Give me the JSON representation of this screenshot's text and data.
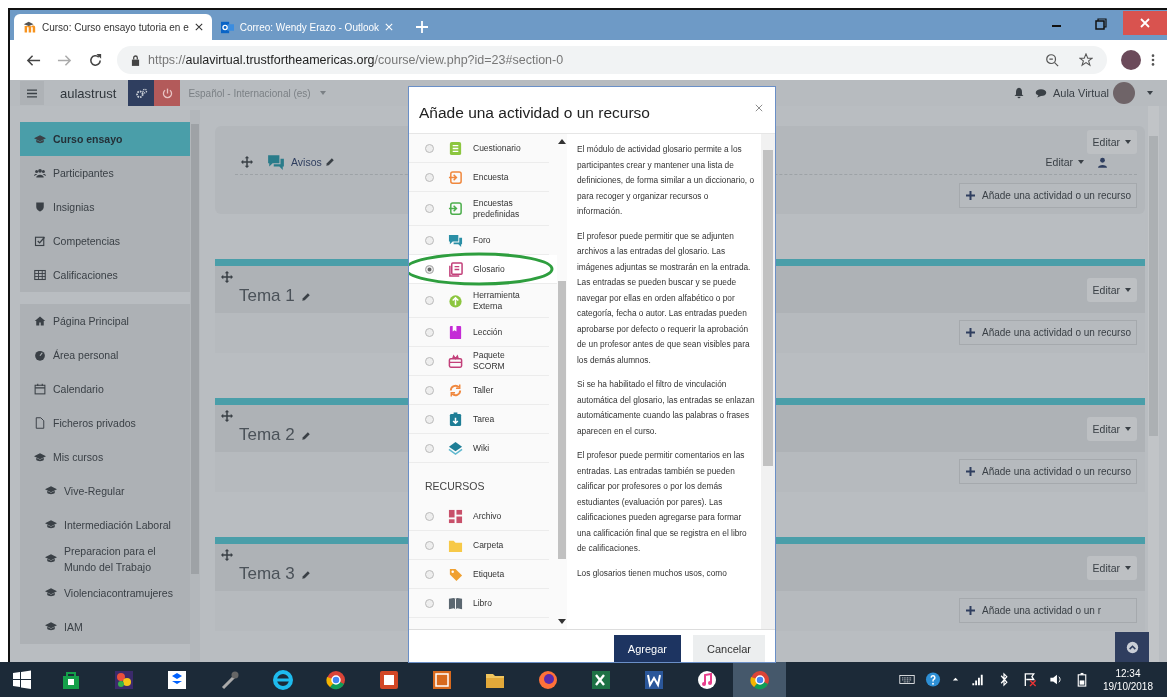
{
  "browser": {
    "tabs": [
      {
        "title": "Curso: Curso ensayo tutoria en e",
        "selected": true
      },
      {
        "title": "Correo: Wendy Erazo - Outlook",
        "selected": false
      }
    ],
    "url": {
      "scheme": "https://",
      "host": "aulavirtual.trustfortheamericas.org",
      "path": "/course/view.php?id=23#section-0"
    }
  },
  "navbar": {
    "brand": "aulastrust",
    "language": "Español - Internacional (es)",
    "user": "Aula Virtual"
  },
  "sidebar": {
    "sections": [
      {
        "items": [
          {
            "label": "Curso ensayo",
            "kind": "course",
            "selected": true
          },
          {
            "label": "Participantes",
            "kind": "users",
            "selected": false
          },
          {
            "label": "Insignias",
            "kind": "badge",
            "selected": false
          },
          {
            "label": "Competencias",
            "kind": "check",
            "selected": false
          },
          {
            "label": "Calificaciones",
            "kind": "table",
            "selected": false
          }
        ]
      },
      {
        "items": [
          {
            "label": "Página Principal",
            "kind": "home",
            "selected": false
          },
          {
            "label": "Área personal",
            "kind": "dashboard",
            "selected": false
          },
          {
            "label": "Calendario",
            "kind": "calendar",
            "selected": false
          },
          {
            "label": "Ficheros privados",
            "kind": "file",
            "selected": false
          },
          {
            "label": "Mis cursos",
            "kind": "course",
            "selected": false,
            "children": [
              {
                "label": "Vive-Regular",
                "kind": "course",
                "selected": false
              },
              {
                "label": "Intermediación Laboral",
                "kind": "course",
                "selected": false
              },
              {
                "label": "Preparacion para el Mundo del Trabajo",
                "kind": "course",
                "selected": false
              },
              {
                "label": "Violenciacontramujeres",
                "kind": "course",
                "selected": false
              },
              {
                "label": "IAM",
                "kind": "course",
                "selected": false
              }
            ]
          }
        ]
      }
    ]
  },
  "course": {
    "section_edit": "Editar",
    "announcements": {
      "title": "Avisos",
      "edit": "Editar",
      "add": "Añade una actividad o un recurso"
    },
    "topics": [
      {
        "title": "Tema 1",
        "edit": "Editar",
        "add": "Añade una actividad o un recurso"
      },
      {
        "title": "Tema 2",
        "edit": "Editar",
        "add": "Añade una actividad o un recurso"
      },
      {
        "title": "Tema 3",
        "edit": "Editar",
        "add": "Añade una actividad o un r"
      }
    ]
  },
  "modal": {
    "title": "Añade una actividad o un recurso",
    "activities": [
      {
        "label": "Cuestionario",
        "kind": "quiz",
        "selected": false
      },
      {
        "label": "Encuesta",
        "kind": "survey",
        "selected": false
      },
      {
        "label": "Encuestas predefinidas",
        "kind": "feedback",
        "selected": false
      },
      {
        "label": "Foro",
        "kind": "forum",
        "selected": false
      },
      {
        "label": "Glosario",
        "kind": "glossary",
        "selected": true
      },
      {
        "label": "Herramienta Externa",
        "kind": "lti",
        "selected": false
      },
      {
        "label": "Lección",
        "kind": "lesson",
        "selected": false
      },
      {
        "label": "Paquete SCORM",
        "kind": "scorm",
        "selected": false
      },
      {
        "label": "Taller",
        "kind": "workshop",
        "selected": false
      },
      {
        "label": "Tarea",
        "kind": "assign",
        "selected": false
      },
      {
        "label": "Wiki",
        "kind": "wiki",
        "selected": false
      }
    ],
    "resources_heading": "RECURSOS",
    "resources": [
      {
        "label": "Archivo",
        "kind": "resource",
        "selected": false
      },
      {
        "label": "Carpeta",
        "kind": "folder",
        "selected": false
      },
      {
        "label": "Etiqueta",
        "kind": "label",
        "selected": false
      },
      {
        "label": "Libro",
        "kind": "book",
        "selected": false
      }
    ],
    "description": [
      "El módulo de actividad glosario permite a los participantes crear y mantener una lista de definiciones, de forma similar a un diccionario, o para recoger y organizar recursos o información.",
      "El profesor puede permitir que se adjunten archivos a las entradas del glosario. Las imágenes adjuntas se mostrarán en la entrada. Las entradas se pueden buscar y se puede navegar por ellas en orden alfabético o por categoría, fecha o autor. Las entradas pueden aprobarse por defecto o requerir la aprobación de un profesor antes de que sean visibles para los demás alumnos.",
      "Si se ha habilitado el filtro de vinculación automática del glosario, las entradas se enlazan automáticamente cuando las palabras o frases aparecen en el curso.",
      "El profesor puede permitir comentarios en las entradas. Las entradas también se pueden calificar por profesores o por los demás estudiantes (evaluación por pares). Las calificaciones pueden agregarse para formar una calificación final que se registra en el libro de calificaciones.",
      "Los glosarios tienen muchos usos, como"
    ],
    "buttons": {
      "primary": "Agregar",
      "secondary": "Cancelar"
    }
  },
  "taskbar": {
    "time": "12:34",
    "date": "19/10/2018"
  }
}
